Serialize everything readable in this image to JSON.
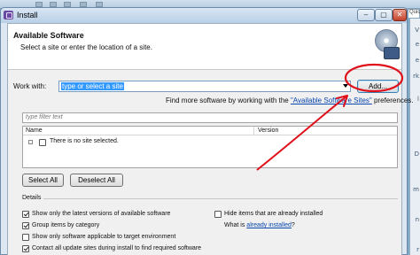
{
  "window": {
    "title": "Install",
    "min_label": "‒",
    "max_label": "▢",
    "close_label": "✕"
  },
  "header": {
    "title": "Available Software",
    "subtitle": "Select a site or enter the location of a site."
  },
  "work_with": {
    "label": "Work with:",
    "placeholder": "type or select a site",
    "add_label": "Add...",
    "more_prefix": "Find more software by working with the",
    "more_link": "\"Available Software Sites\"",
    "more_suffix": "preferences."
  },
  "filter": {
    "placeholder": "type filter text"
  },
  "table": {
    "columns": [
      "Name",
      "Version"
    ],
    "rows": [
      {
        "name": "There is no site selected.",
        "checked": false
      }
    ]
  },
  "buttons": {
    "select_all": "Select All",
    "deselect_all": "Deselect All"
  },
  "details": {
    "label": "Details"
  },
  "options": {
    "latest_versions": {
      "label": "Show only the latest versions of available software",
      "checked": true
    },
    "group_by_category": {
      "label": "Group items by category",
      "checked": true
    },
    "target_env": {
      "label": "Show only software applicable to target environment",
      "checked": false
    },
    "contact_sites": {
      "label": "Contact all update sites during install to find required software",
      "checked": true
    },
    "hide_installed": {
      "label": "Hide items that are already installed",
      "checked": false
    },
    "what_is_prefix": "What is",
    "what_is_link": "already installed",
    "what_is_suffix": "?"
  },
  "background": {
    "quick_label": "Quic",
    "side_letters": [
      "V",
      "e",
      "e",
      "rk",
      "l",
      "D",
      "m",
      "n",
      "r"
    ]
  },
  "colors": {
    "annotation": "#e0101a",
    "link": "#0645ad",
    "selection": "#3399ff"
  }
}
